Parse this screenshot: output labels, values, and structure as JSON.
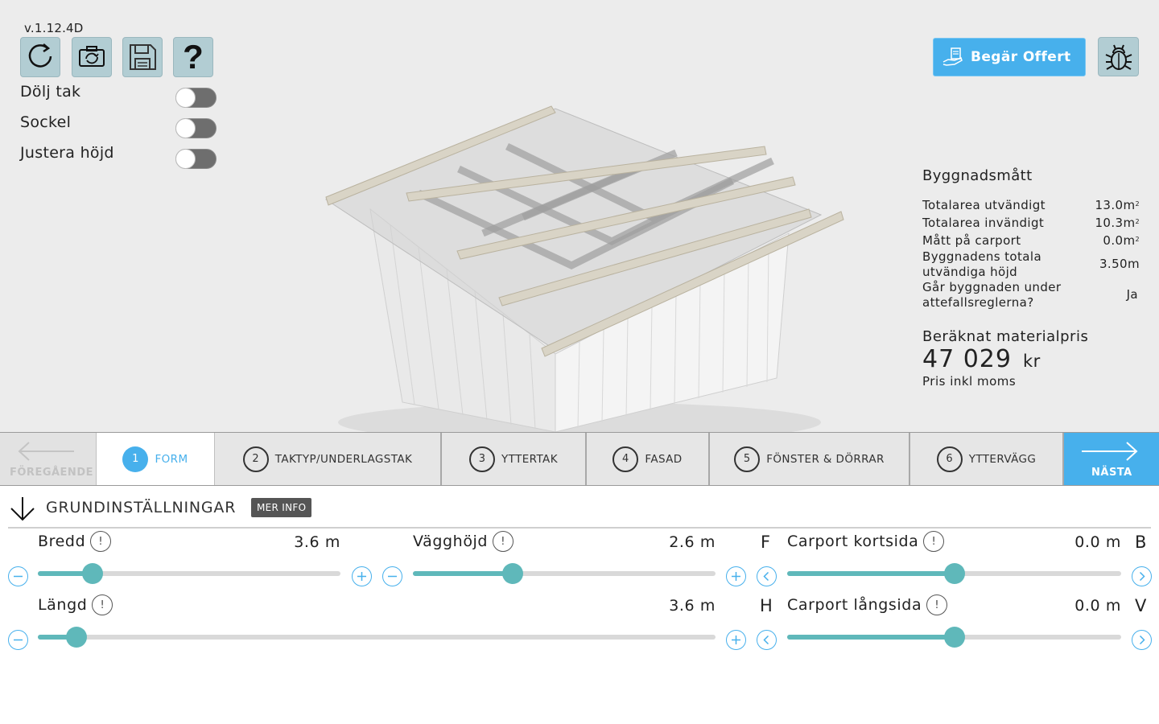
{
  "app": {
    "version": "v.1.12.4D"
  },
  "toolbar": {
    "buttons": [
      {
        "name": "refresh-icon"
      },
      {
        "name": "camera-rotate-icon"
      },
      {
        "name": "save-icon"
      },
      {
        "name": "help-icon",
        "glyph": "?"
      }
    ]
  },
  "toggles": [
    {
      "label": "Dölj tak",
      "on": false
    },
    {
      "label": "Sockel",
      "on": false
    },
    {
      "label": "Justera höjd",
      "on": false
    }
  ],
  "header": {
    "quote_label": "Begär Offert"
  },
  "stats": {
    "title": "Byggnadsmått",
    "rows": [
      {
        "label": "Totalarea utvändigt",
        "value": "13.0m",
        "sup": "2"
      },
      {
        "label": "Totalarea invändigt",
        "value": "10.3m",
        "sup": "2"
      },
      {
        "label": "Mått på carport",
        "value": "0.0m",
        "sup": "2"
      },
      {
        "label": "Byggnadens totala utvändiga höjd",
        "value": "3.50m",
        "sup": ""
      },
      {
        "label": "Går byggnaden under attefallsreglerna?",
        "value": "Ja",
        "sup": ""
      }
    ],
    "price_title": "Beräknat materialpris",
    "price_value": "47 029",
    "price_unit": "kr",
    "price_note": "Pris inkl moms"
  },
  "steps": {
    "prev_label": "FÖREGÅENDE",
    "next_label": "NÄSTA",
    "items": [
      {
        "num": "1",
        "label": "FORM",
        "active": true
      },
      {
        "num": "2",
        "label": "TAKTYP/UNDERLAGSTAK",
        "active": false
      },
      {
        "num": "3",
        "label": "YTTERTAK",
        "active": false
      },
      {
        "num": "4",
        "label": "FASAD",
        "active": false
      },
      {
        "num": "5",
        "label": "FÖNSTER & DÖRRAR",
        "active": false
      },
      {
        "num": "6",
        "label": "YTTERVÄGG",
        "active": false
      }
    ]
  },
  "settings": {
    "title": "GRUNDINSTÄLLNINGAR",
    "more_info": "MER INFO",
    "info_glyph": "!",
    "sliders": [
      {
        "label": "Bredd",
        "value": "3.6 m",
        "fraction": 0.18
      },
      {
        "label": "Vägghöjd",
        "value": "2.6 m",
        "fraction": 0.33
      },
      {
        "label": "Längd",
        "value": "3.6 m",
        "fraction": 0.057
      },
      {
        "label": "Carport kortsida",
        "value": "0.0 m",
        "fraction": 0.5,
        "left_letter": "F",
        "right_letter": "B"
      },
      {
        "label": "Carport långsida",
        "value": "0.0 m",
        "fraction": 0.5,
        "left_letter": "H",
        "right_letter": "V"
      }
    ]
  },
  "colors": {
    "accent": "#47b0ec",
    "slider": "#5fb8ba",
    "tool_button": "#b2cdd3",
    "viewport_bg": "#ececec"
  }
}
